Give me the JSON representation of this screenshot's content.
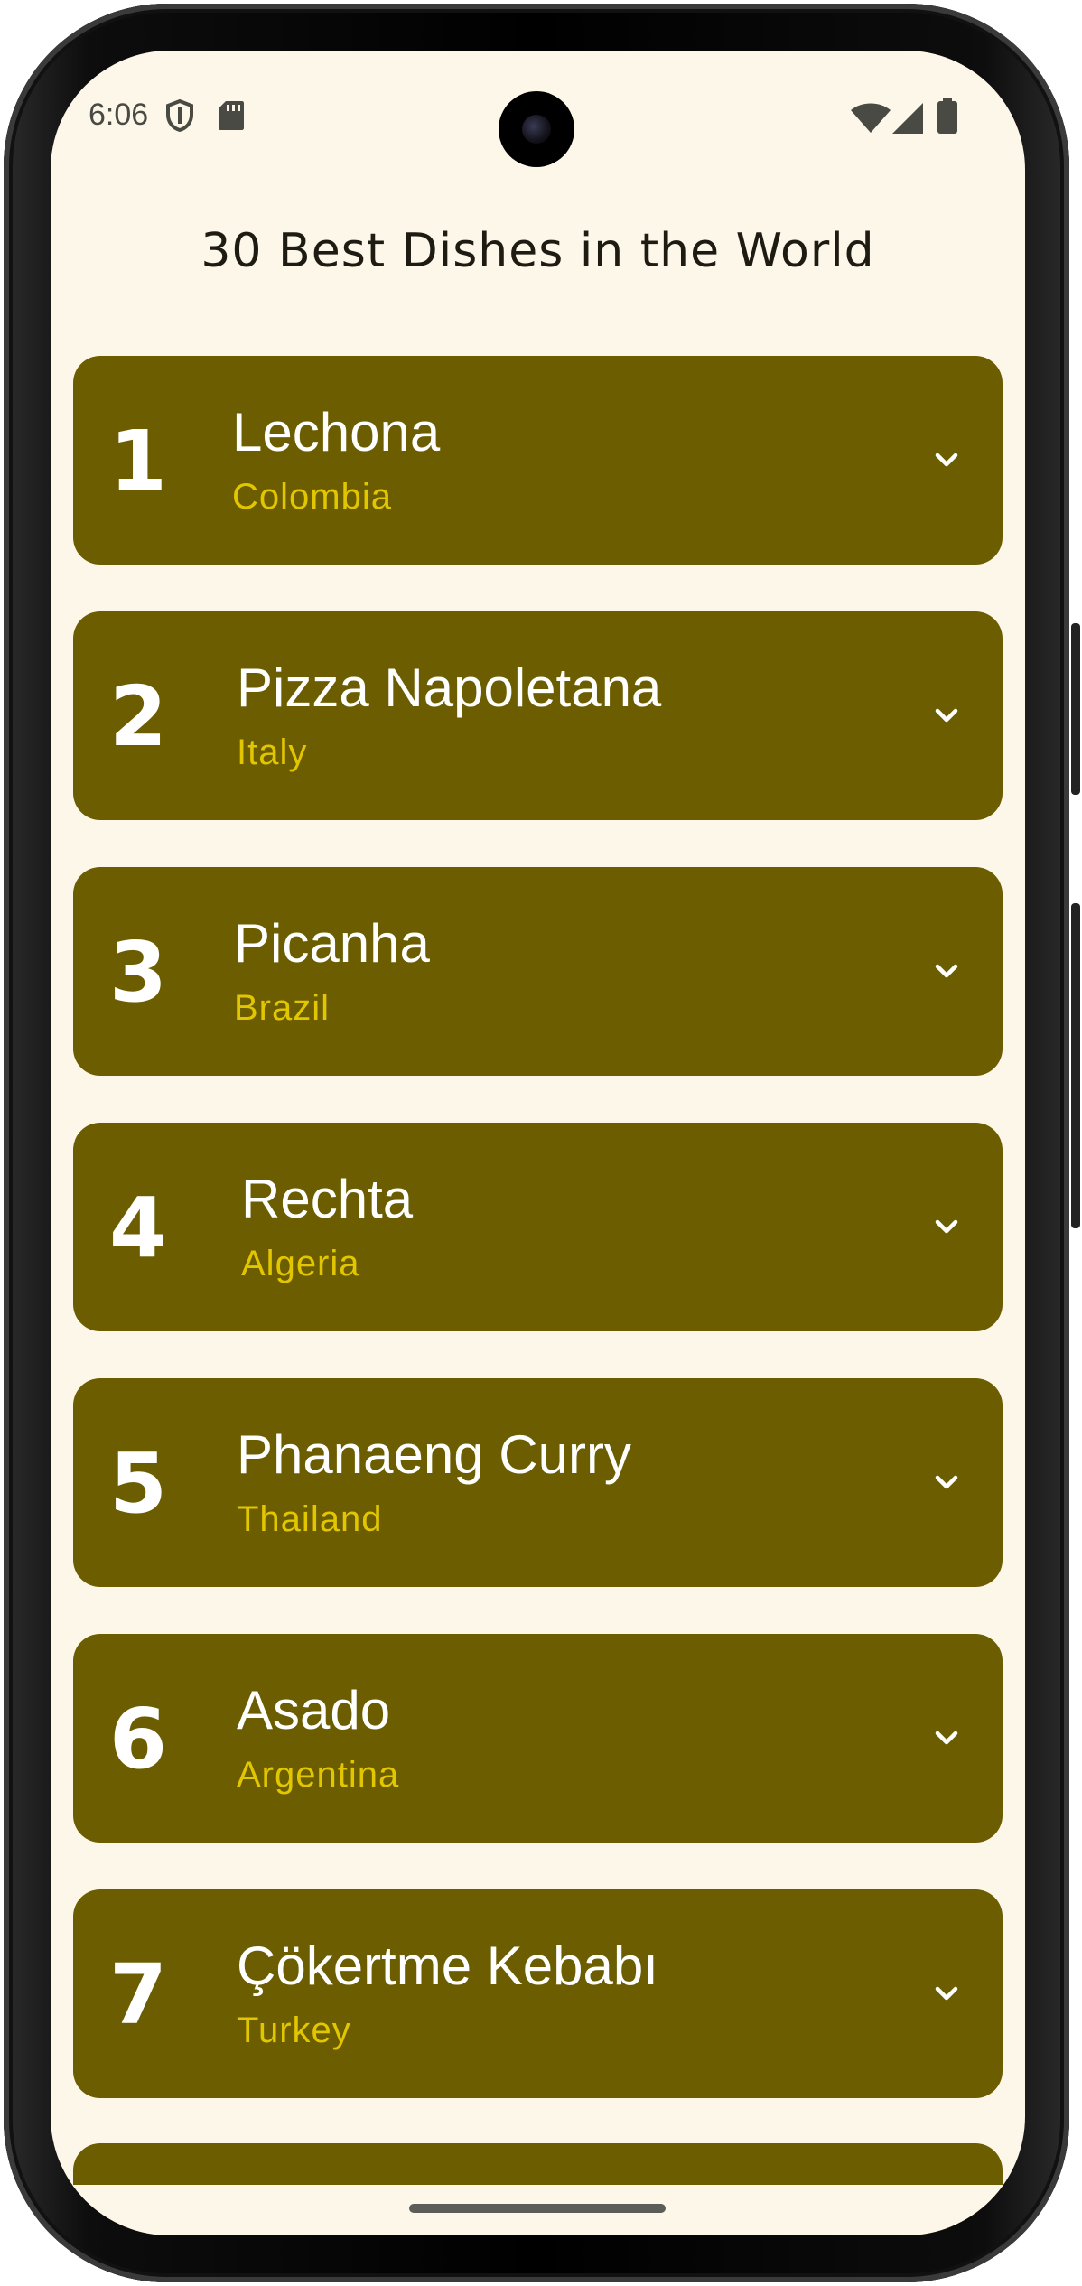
{
  "status_bar": {
    "time": "6:06",
    "icons": [
      "shield-icon",
      "sd-card-icon",
      "wifi-icon",
      "cell-signal-icon",
      "battery-icon"
    ]
  },
  "app": {
    "title": "30 Best Dishes in the World"
  },
  "dishes": [
    {
      "rank": "1",
      "name": "Lechona",
      "country": "Colombia"
    },
    {
      "rank": "2",
      "name": "Pizza Napoletana",
      "country": "Italy"
    },
    {
      "rank": "3",
      "name": "Picanha",
      "country": "Brazil"
    },
    {
      "rank": "4",
      "name": "Rechta",
      "country": "Algeria"
    },
    {
      "rank": "5",
      "name": "Phanaeng Curry",
      "country": "Thailand"
    },
    {
      "rank": "6",
      "name": "Asado",
      "country": "Argentina"
    },
    {
      "rank": "7",
      "name": "Çökertme Kebabı",
      "country": "Turkey"
    }
  ],
  "colors": {
    "background": "#fdf7e9",
    "card": "#6b5d00",
    "card_text": "#ffffff",
    "country_text": "#e2c700",
    "title_text": "#1e1b13"
  }
}
